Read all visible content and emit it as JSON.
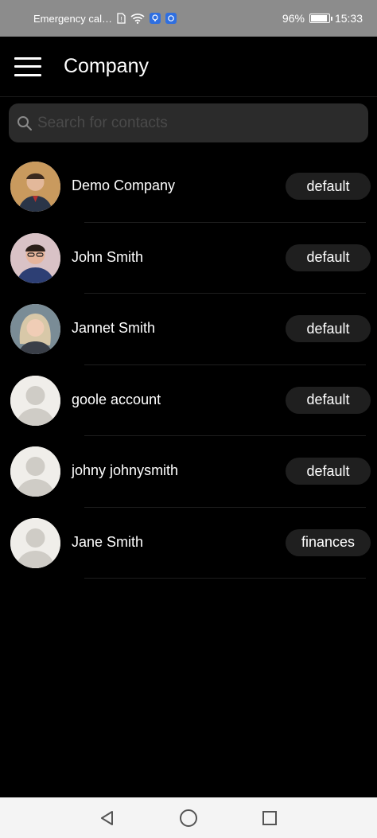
{
  "status": {
    "carrier": "Emergency cal…",
    "battery": "96%",
    "battery_level": 0.96,
    "time": "15:33"
  },
  "header": {
    "title": "Company",
    "menu_icon": "hamburger-menu-icon"
  },
  "search": {
    "placeholder": "Search for contacts",
    "value": ""
  },
  "contacts": [
    {
      "name": "Demo Company",
      "tag": "default",
      "avatar": "photo"
    },
    {
      "name": "John Smith",
      "tag": "default",
      "avatar": "photo"
    },
    {
      "name": "Jannet Smith",
      "tag": "default",
      "avatar": "photo"
    },
    {
      "name": "goole account",
      "tag": "default",
      "avatar": "placeholder"
    },
    {
      "name": "johny johnysmith",
      "tag": "default",
      "avatar": "placeholder"
    },
    {
      "name": "Jane Smith",
      "tag": "finances",
      "avatar": "placeholder"
    }
  ],
  "navigation": {
    "back_icon": "back-triangle-icon",
    "home_icon": "home-circle-icon",
    "recents_icon": "recents-square-icon"
  },
  "colors": {
    "background": "#000000",
    "search_bg": "#2b2b2b",
    "tag_bg": "#1f1f1f",
    "status_bar": "#8c8c8c"
  }
}
